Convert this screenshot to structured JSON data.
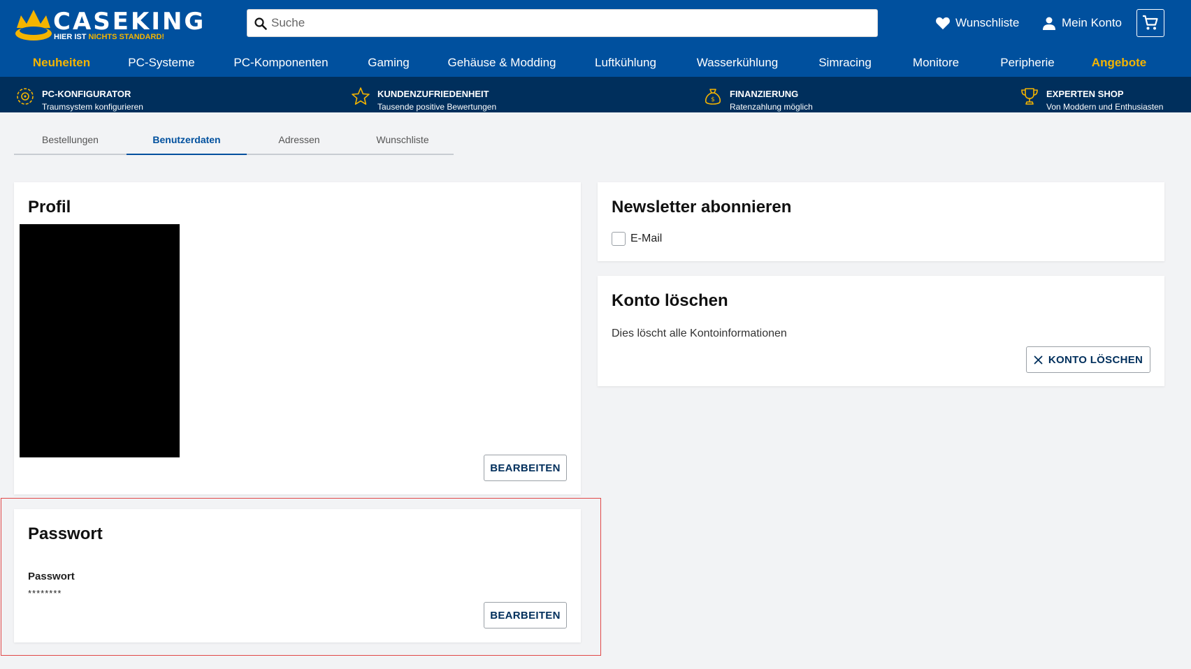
{
  "brand": {
    "name": "CASEKING",
    "tagline_white": "HIER IST",
    "tagline_accent": "NICHTS STANDARD!"
  },
  "search": {
    "placeholder": "Suche"
  },
  "header_links": {
    "wishlist": "Wunschliste",
    "account": "Mein Konto"
  },
  "nav": [
    "Neuheiten",
    "PC-Systeme",
    "PC-Komponenten",
    "Gaming",
    "Gehäuse & Modding",
    "Luftkühlung",
    "Wasserkühlung",
    "Simracing",
    "Monitore",
    "Peripherie",
    "Angebote"
  ],
  "usp": [
    {
      "title": "PC-KONFIGURATOR",
      "subtitle": "Traumsystem konfigurieren",
      "icon": "gear-cog-icon"
    },
    {
      "title": "KUNDENZUFRIEDENHEIT",
      "subtitle": "Tausende positive Bewertungen",
      "icon": "star-icon"
    },
    {
      "title": "FINANZIERUNG",
      "subtitle": "Ratenzahlung möglich",
      "icon": "money-bag-icon"
    },
    {
      "title": "EXPERTEN SHOP",
      "subtitle": "Von Moddern und Enthusiasten",
      "icon": "trophy-icon"
    }
  ],
  "tabs": [
    "Bestellungen",
    "Benutzerdaten",
    "Adressen",
    "Wunschliste"
  ],
  "active_tab": "Benutzerdaten",
  "profile": {
    "title": "Profil",
    "edit": "BEARBEITEN"
  },
  "password": {
    "title": "Passwort",
    "label": "Passwort",
    "value": "********",
    "edit": "BEARBEITEN"
  },
  "newsletter": {
    "title": "Newsletter abonnieren",
    "email_label": "E-Mail",
    "email_checked": false
  },
  "delete": {
    "title": "Konto löschen",
    "description": "Dies löscht alle Kontoinformationen",
    "button": "KONTO LÖSCHEN"
  },
  "colors": {
    "header_blue": "#00509e",
    "usp_navy": "#002f5c",
    "accent_yellow": "#f4b400",
    "highlight_red": "#e04848"
  }
}
